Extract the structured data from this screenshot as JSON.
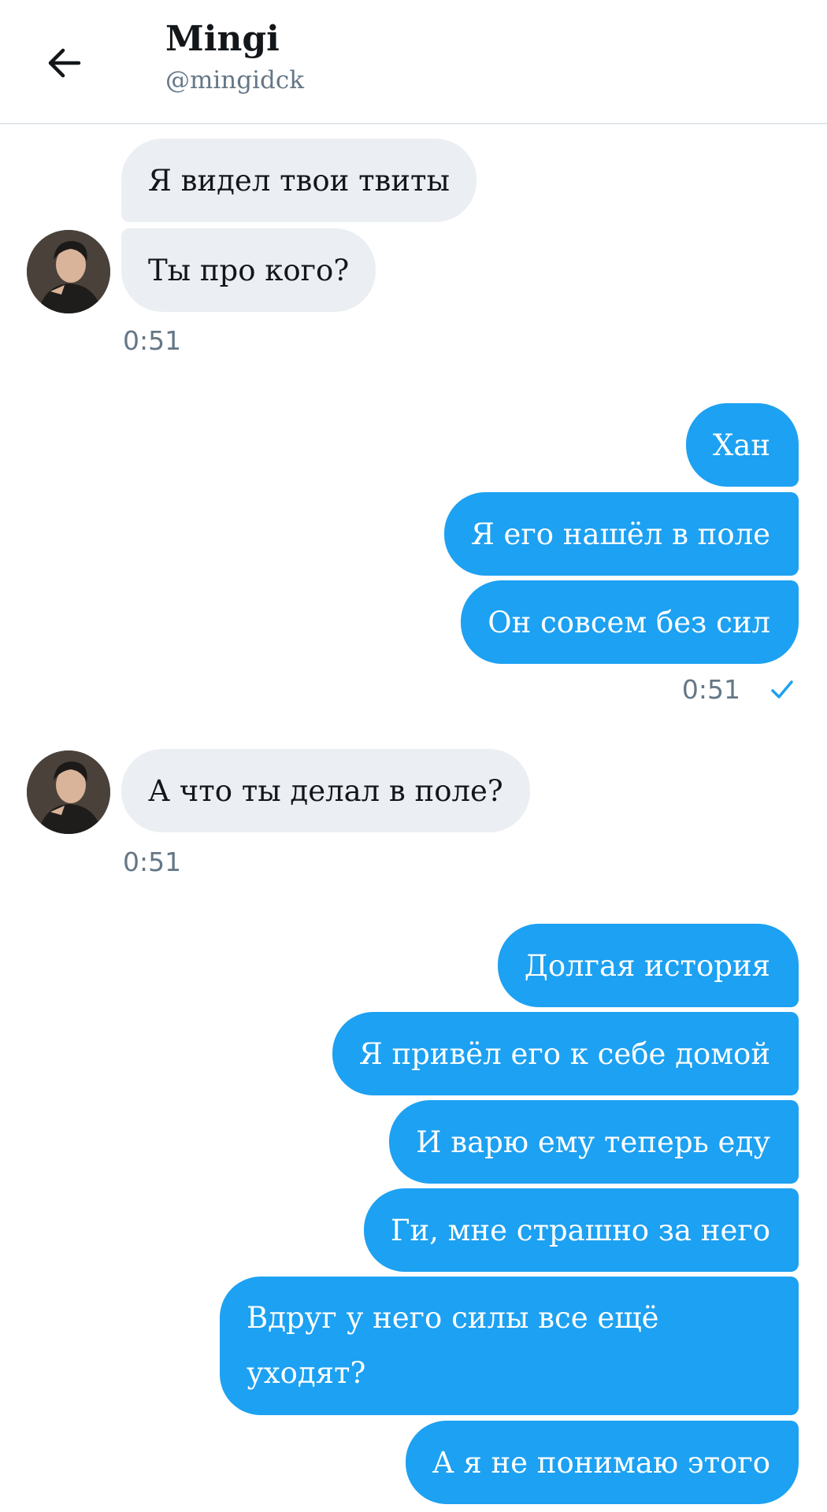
{
  "header": {
    "title": "Mingi",
    "handle": "@mingidck",
    "back_icon": "arrow-left-icon"
  },
  "messages": [
    {
      "dir": "in",
      "text": "Я видел твои твиты"
    },
    {
      "dir": "in",
      "text": "Ты про кого?"
    },
    {
      "dir": "out",
      "text": "Хан"
    },
    {
      "dir": "out",
      "text": "Я его нашёл в поле"
    },
    {
      "dir": "out",
      "text": "Он совсем без сил"
    },
    {
      "dir": "in",
      "text": "А что ты делал в поле?"
    },
    {
      "dir": "out",
      "text": "Долгая история"
    },
    {
      "dir": "out",
      "text": "Я привёл его к себе домой"
    },
    {
      "dir": "out",
      "text": "И варю ему теперь еду"
    },
    {
      "dir": "out",
      "text": "Ги, мне страшно за него"
    },
    {
      "dir": "out",
      "text": "Вдруг у него силы все ещё уходят?"
    },
    {
      "dir": "out",
      "text": "А я не понимаю этого"
    }
  ],
  "timestamps": [
    "0:51",
    "0:51",
    "0:51"
  ],
  "read_icon": "checkmark-icon",
  "colors": {
    "outgoing_bubble": "#1da1f2",
    "incoming_bubble": "#ebeef3",
    "text_dark": "#14171a",
    "text_muted": "#657786"
  }
}
